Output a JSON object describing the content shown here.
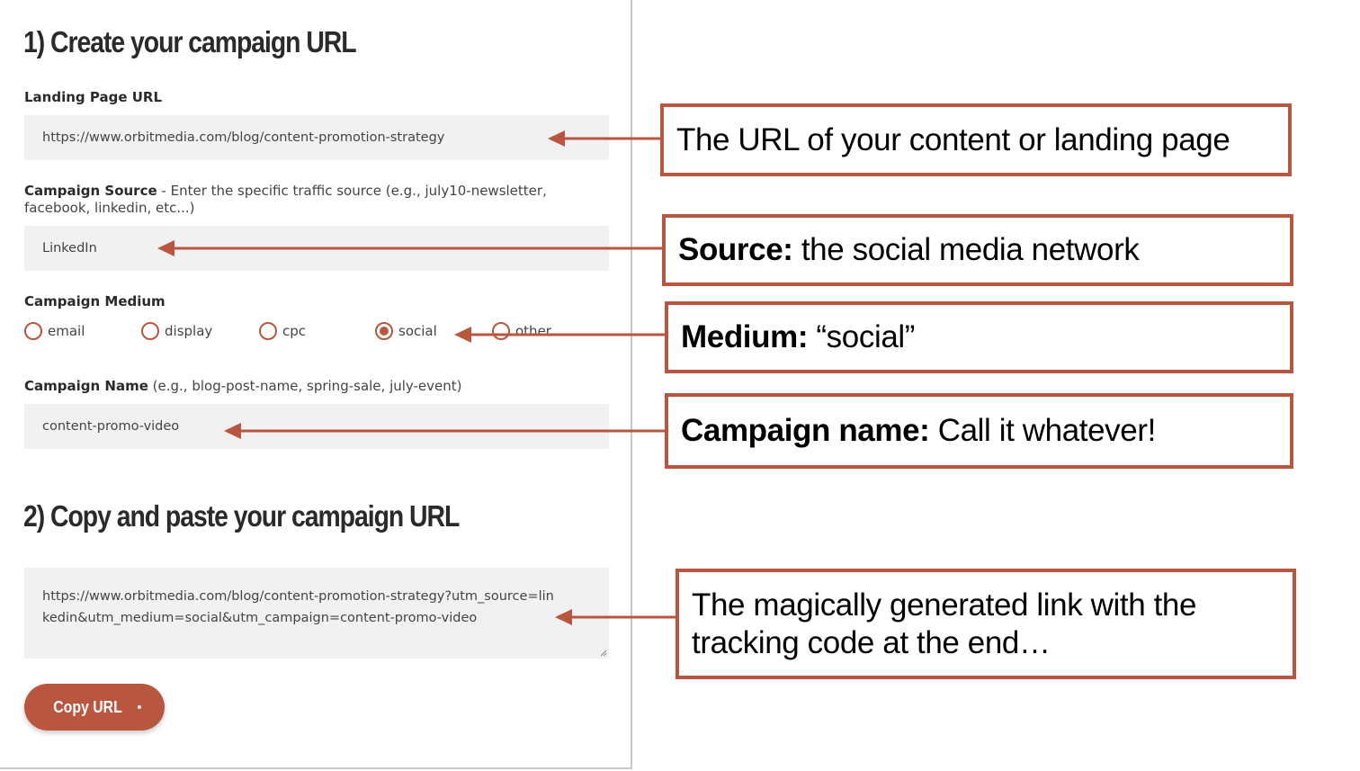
{
  "form": {
    "section1_title": "1) Create your campaign URL",
    "landing_page": {
      "label": "Landing Page URL",
      "value": "https://www.orbitmedia.com/blog/content-promotion-strategy"
    },
    "campaign_source": {
      "label": "Campaign Source",
      "hint": " - Enter the specific traffic source (e.g., july10-newsletter, facebook, linkedin, etc...)",
      "value": "LinkedIn"
    },
    "campaign_medium": {
      "label": "Campaign Medium",
      "options": [
        {
          "label": "email",
          "selected": false
        },
        {
          "label": "display",
          "selected": false
        },
        {
          "label": "cpc",
          "selected": false
        },
        {
          "label": "social",
          "selected": true
        },
        {
          "label": "other",
          "selected": false
        }
      ]
    },
    "campaign_name": {
      "label": "Campaign Name",
      "hint": " (e.g., blog-post-name, spring-sale, july-event)",
      "value": "content-promo-video"
    },
    "section2_title": "2) Copy and paste your campaign URL",
    "generated_url": "https://www.orbitmedia.com/blog/content-promotion-strategy?utm_source=linkedin&utm_medium=social&utm_campaign=content-promo-video",
    "copy_button_label": "Copy URL"
  },
  "callouts": {
    "url": {
      "bold": "",
      "text": "The URL of your content or landing page"
    },
    "source": {
      "bold": "Source:",
      "text": " the social media network"
    },
    "medium": {
      "bold": "Medium:",
      "text": " “social”"
    },
    "name": {
      "bold": "Campaign name:",
      "text": " Call it whatever!"
    },
    "link": {
      "bold": "",
      "text": "The magically generated link with the tracking code at the end…"
    }
  },
  "colors": {
    "accent": "#b85640",
    "field_bg": "#f1f1f1",
    "panel_border": "#c8c8c8"
  }
}
